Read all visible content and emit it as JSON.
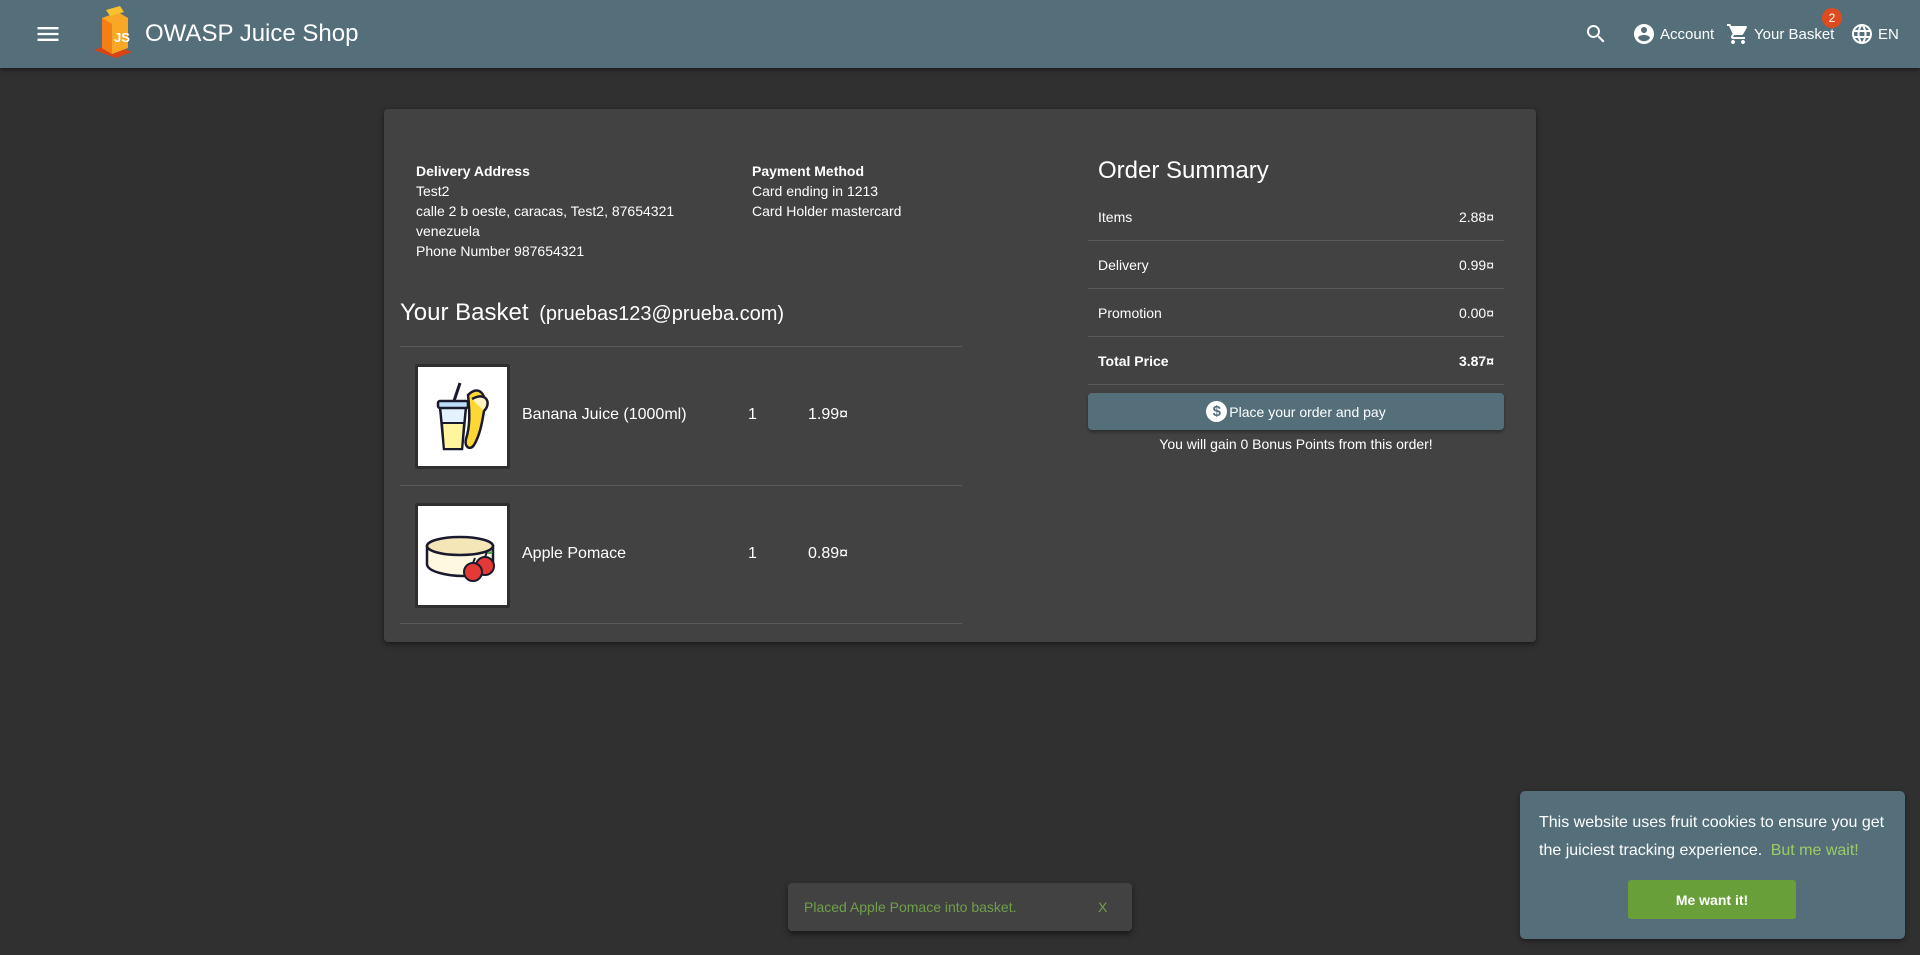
{
  "header": {
    "title": "OWASP Juice Shop",
    "account_label": "Account",
    "basket_label": "Your Basket",
    "basket_count": "2",
    "language_label": "EN",
    "bar_color": "#546e7a"
  },
  "delivery": {
    "title": "Delivery Address",
    "name": "Test2",
    "street": "calle 2 b oeste, caracas, Test2, 87654321",
    "country": "venezuela",
    "phone": "Phone Number 987654321"
  },
  "payment": {
    "title": "Payment Method",
    "card": "Card ending in 1213",
    "holder": "Card Holder mastercard"
  },
  "basket": {
    "title": "Your Basket",
    "email": "(pruebas123@prueba.com)",
    "items": [
      {
        "name": "Banana Juice (1000ml)",
        "quantity": "1",
        "price": "1.99¤",
        "icon": "banana-juice-icon"
      },
      {
        "name": "Apple Pomace",
        "quantity": "1",
        "price": "0.89¤",
        "icon": "apple-pomace-icon"
      }
    ]
  },
  "summary": {
    "title": "Order Summary",
    "rows": [
      {
        "label": "Items",
        "value": "2.88¤"
      },
      {
        "label": "Delivery",
        "value": "0.99¤"
      },
      {
        "label": "Promotion",
        "value": "0.00¤"
      },
      {
        "label": "Total Price",
        "value": "3.87¤"
      }
    ],
    "place_order_label": "Place your order and pay",
    "bonus_text": "You will gain 0 Bonus Points from this order!"
  },
  "snackbar": {
    "message": "Placed Apple Pomace into basket.",
    "close_label": "X"
  },
  "cookie": {
    "text": "This website uses fruit cookies to ensure you get the juiciest tracking experience.",
    "link_label": "But me wait!",
    "accept_label": "Me want it!",
    "accent_color": "#689f38"
  }
}
